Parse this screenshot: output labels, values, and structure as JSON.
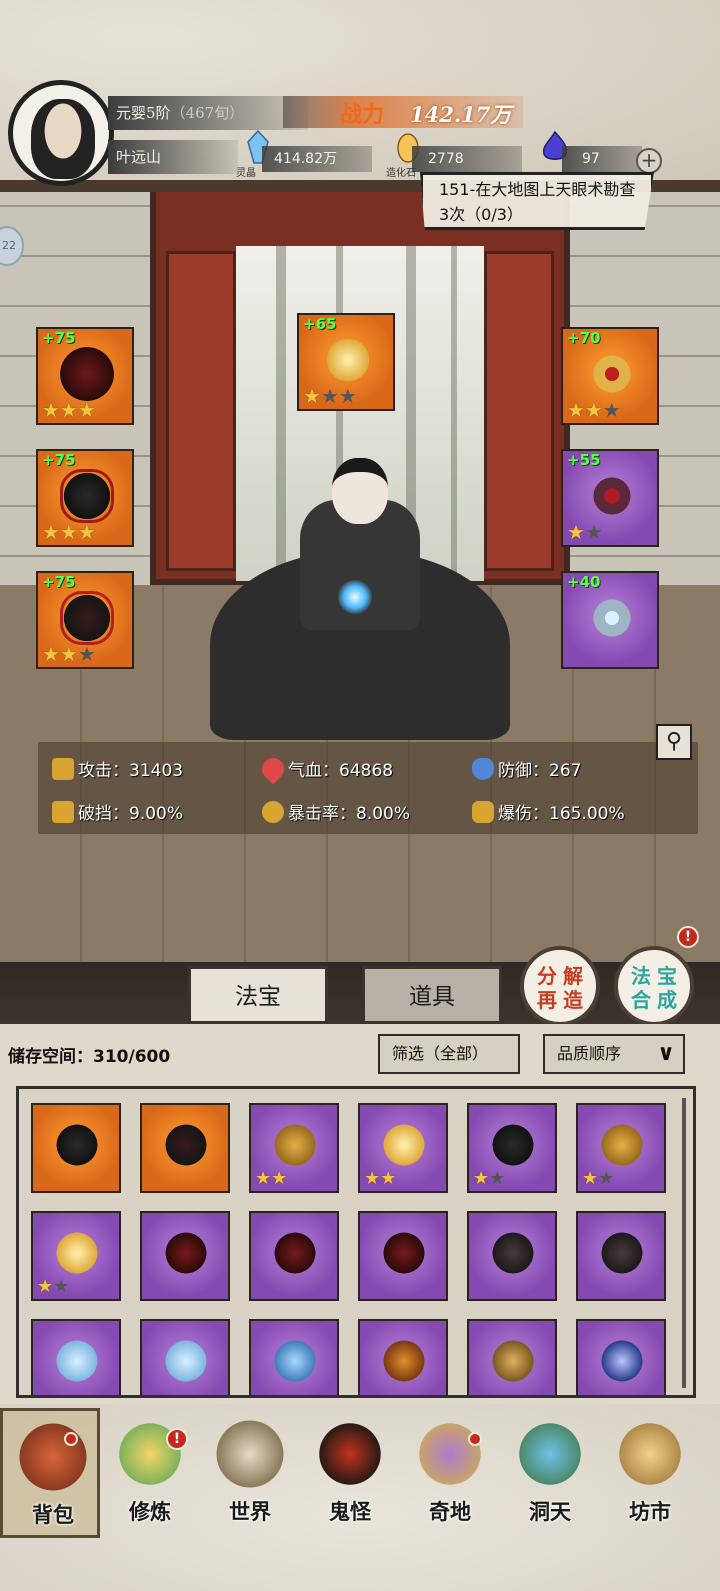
{
  "header": {
    "realm": "元婴5阶",
    "realm_suffix": "（467旬）",
    "player_name": "叶远山",
    "power_label": "战力",
    "power_value": "142.17万",
    "resources": [
      {
        "name": "灵晶",
        "value": "414.82万",
        "icon": "crystal-icon",
        "color": "#6fb3e8"
      },
      {
        "name": "造化石",
        "value": "2778",
        "icon": "creation-stone-icon",
        "color": "#f0b040"
      },
      {
        "name": "",
        "value": "97",
        "icon": "soul-flame-icon",
        "color": "#5a4fd8"
      }
    ],
    "plus": "+",
    "side_tab": "22"
  },
  "quest": {
    "text": "151-在大地图上天眼术勘查3次（0/3）"
  },
  "equipment": [
    {
      "slot": "weapon",
      "level": "+75",
      "stars": 3,
      "max_stars": 3,
      "rarity": "orange"
    },
    {
      "slot": "armor",
      "level": "+75",
      "stars": 3,
      "max_stars": 3,
      "rarity": "orange"
    },
    {
      "slot": "boots",
      "level": "+75",
      "stars": 2,
      "max_stars": 3,
      "rarity": "orange"
    },
    {
      "slot": "talisman",
      "level": "+65",
      "stars": 1,
      "max_stars": 3,
      "rarity": "orange"
    },
    {
      "slot": "crown",
      "level": "+70",
      "stars": 2,
      "max_stars": 3,
      "rarity": "orange"
    },
    {
      "slot": "necklace",
      "level": "+55",
      "stars": 1,
      "max_stars": 2,
      "rarity": "purple"
    },
    {
      "slot": "ring",
      "level": "+40",
      "stars": 0,
      "max_stars": 0,
      "rarity": "purple"
    }
  ],
  "stats": [
    {
      "label": "攻击：",
      "value": "31403",
      "icon": "sword-icon"
    },
    {
      "label": "气血：",
      "value": "64868",
      "icon": "heart-icon"
    },
    {
      "label": "防御：",
      "value": "267",
      "icon": "shield-icon"
    },
    {
      "label": "破挡：",
      "value": "9.00%",
      "icon": "break-guard-icon"
    },
    {
      "label": "暴击率：",
      "value": "8.00%",
      "icon": "crit-rate-icon"
    },
    {
      "label": "爆伤：",
      "value": "165.00%",
      "icon": "crit-damage-icon"
    }
  ],
  "tabs": {
    "treasure": "法宝",
    "items": "道具"
  },
  "actions": {
    "decompose_line1": "分解",
    "decompose_line2": "再造",
    "synth_line1": "法宝",
    "synth_line2": "合成",
    "synth_badge": "!"
  },
  "inventory": {
    "storage_label": "储存空间：",
    "storage_value": "310/600",
    "filter_label": "筛选（全部）",
    "sort_label": "品质顺序",
    "items": [
      {
        "kind": "armor",
        "rarity": "orange",
        "stars": 0,
        "max_stars": 0
      },
      {
        "kind": "boots",
        "rarity": "orange",
        "stars": 0,
        "max_stars": 0
      },
      {
        "kind": "crown",
        "rarity": "purple",
        "stars": 2,
        "max_stars": 2
      },
      {
        "kind": "talisman",
        "rarity": "purple",
        "stars": 2,
        "max_stars": 2
      },
      {
        "kind": "armor",
        "rarity": "purple",
        "stars": 1,
        "max_stars": 2
      },
      {
        "kind": "crown",
        "rarity": "purple",
        "stars": 1,
        "max_stars": 2
      },
      {
        "kind": "talisman",
        "rarity": "purple",
        "stars": 1,
        "max_stars": 2
      },
      {
        "kind": "weapon",
        "rarity": "purple",
        "stars": 0,
        "max_stars": 0
      },
      {
        "kind": "weapon",
        "rarity": "purple",
        "stars": 0,
        "max_stars": 0
      },
      {
        "kind": "weapon",
        "rarity": "purple",
        "stars": 0,
        "max_stars": 0
      },
      {
        "kind": "wheel",
        "rarity": "purple",
        "stars": 0,
        "max_stars": 0
      },
      {
        "kind": "wheel",
        "rarity": "purple",
        "stars": 0,
        "max_stars": 0
      },
      {
        "kind": "sword",
        "rarity": "purple",
        "stars": 0,
        "max_stars": 0
      },
      {
        "kind": "sword",
        "rarity": "purple",
        "stars": 0,
        "max_stars": 0
      },
      {
        "kind": "spirit",
        "rarity": "purple",
        "stars": 0,
        "max_stars": 0
      },
      {
        "kind": "axe",
        "rarity": "purple",
        "stars": 0,
        "max_stars": 0
      },
      {
        "kind": "staff",
        "rarity": "purple",
        "stars": 0,
        "max_stars": 0
      },
      {
        "kind": "orb",
        "rarity": "purple",
        "stars": 0,
        "max_stars": 0
      }
    ]
  },
  "nav": [
    {
      "label": "背包",
      "icon": "bag-icon",
      "dot": true,
      "active": true
    },
    {
      "label": "修炼",
      "icon": "cultivate-icon",
      "badge": "!"
    },
    {
      "label": "世界",
      "icon": "world-icon"
    },
    {
      "label": "鬼怪",
      "icon": "ghost-icon"
    },
    {
      "label": "奇地",
      "icon": "wonder-land-icon",
      "dot": true
    },
    {
      "label": "洞天",
      "icon": "grotto-icon"
    },
    {
      "label": "坊市",
      "icon": "market-icon"
    }
  ],
  "colors": {
    "orange_quality": "#e8781f",
    "purple_quality": "#9a5cc4",
    "level_green": "#58ff45",
    "power_orange": "#f06a1a",
    "badge_red": "#c32a1c"
  }
}
